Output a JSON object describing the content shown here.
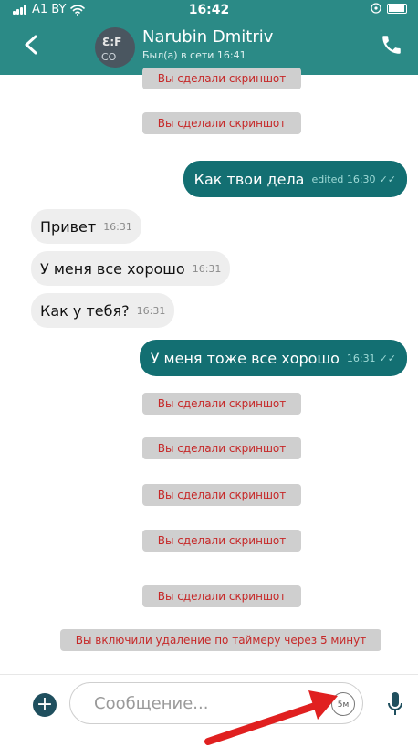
{
  "status": {
    "carrier": "A1 BY",
    "time": "16:42"
  },
  "header": {
    "name": "Narubin Dmitriv",
    "presence": "Был(а) в сети 16:41",
    "avatar_line1": "Ɛ:F",
    "avatar_line2": "CO"
  },
  "messages": {
    "sys1": "Вы сделали скриншот",
    "sys2": "Вы сделали скриншот",
    "out1": {
      "text": "Как твои дела",
      "meta": "edited 16:30"
    },
    "in1": {
      "text": "Привет",
      "time": "16:31"
    },
    "in2": {
      "text": "У меня все хорошо",
      "time": "16:31"
    },
    "in3": {
      "text": "Как у тебя?",
      "time": "16:31"
    },
    "out2": {
      "text": "У меня тоже все хорошо",
      "time": "16:31"
    },
    "sys3": "Вы сделали скриншот",
    "sys4": "Вы сделали скриншот",
    "sys5": "Вы сделали скриншот",
    "sys6": "Вы сделали скриншот",
    "sys7": "Вы сделали скриншот",
    "sys8": "Вы включили удаление по таймеру через 5 минут"
  },
  "input": {
    "placeholder": "Сообщение...",
    "timer": "5м"
  },
  "colors": {
    "header": "#2b8a86",
    "outgoing": "#136f72",
    "incoming": "#eeeeee",
    "system_text": "#c62828",
    "arrow": "#e02020"
  },
  "icons": {
    "back": "chevron-left-icon",
    "call": "phone-icon",
    "plus": "plus-circle-icon",
    "mic": "microphone-icon"
  }
}
